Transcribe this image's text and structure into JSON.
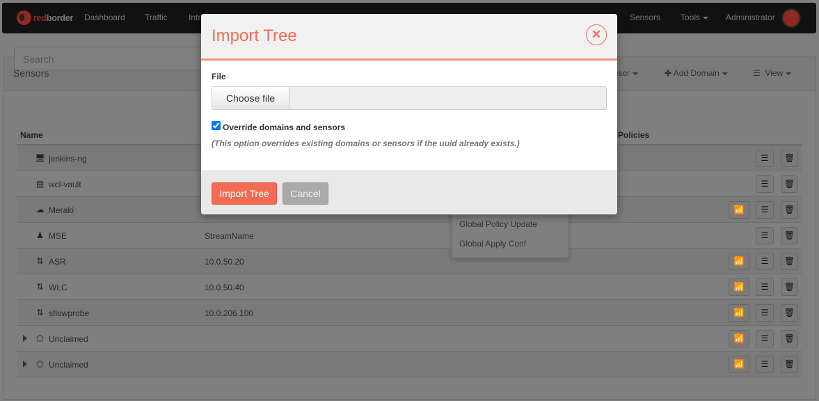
{
  "nav": {
    "brand_red": "red",
    "brand_rest": "border",
    "items": [
      "Dashboard",
      "Traffic",
      "Intr",
      "Sensors",
      "Tools",
      "Administrator"
    ]
  },
  "panel": {
    "title": "Sensors",
    "tools": [
      "ensor",
      "Add Domain",
      "View"
    ],
    "search_placeholder": "Search",
    "columns": [
      "Name",
      "Policies"
    ]
  },
  "rows": [
    {
      "name": "jenkins-ng",
      "ip": "",
      "icon": "monitor-icon",
      "wifi": false,
      "expand": false
    },
    {
      "name": "wcl-vault",
      "ip": "",
      "icon": "server-icon",
      "wifi": false,
      "expand": false
    },
    {
      "name": "Meraki",
      "ip": "",
      "icon": "meraki-icon",
      "wifi": true,
      "expand": false
    },
    {
      "name": "MSE",
      "ip": "StreamName",
      "icon": "person-icon",
      "wifi": false,
      "expand": false
    },
    {
      "name": "ASR",
      "ip": "10.0.50.20",
      "icon": "flow-icon",
      "wifi": true,
      "expand": false
    },
    {
      "name": "WLC",
      "ip": "10.0.50.40",
      "icon": "flow-icon",
      "wifi": true,
      "expand": false
    },
    {
      "name": "sflowprobe",
      "ip": "10.0.206.100",
      "icon": "flow-icon",
      "wifi": true,
      "expand": false
    },
    {
      "name": "Unclaimed",
      "ip": "",
      "icon": "network-icon",
      "wifi": true,
      "expand": true
    },
    {
      "name": "Unclaimed",
      "ip": "",
      "icon": "network-icon",
      "wifi": true,
      "expand": true
    }
  ],
  "dropdown": {
    "items": [
      "Global Policy Update",
      "Global Apply Conf"
    ]
  },
  "modal": {
    "title": "Import Tree",
    "file_label": "File",
    "choose_file": "Choose file",
    "override_label": "Override domains and sensors",
    "override_checked": true,
    "note": "(This option overrides existing domains or sensors if the uuid already exists.)",
    "submit": "Import Tree",
    "cancel": "Cancel"
  },
  "colors": {
    "accent": "#f26c55",
    "navbar": "#111111"
  }
}
